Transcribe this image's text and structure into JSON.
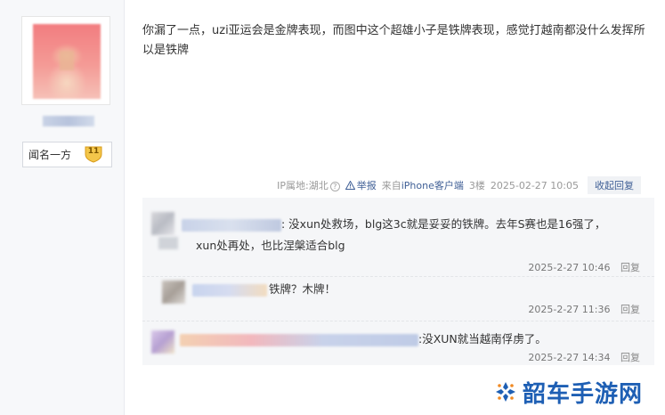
{
  "author": {
    "title": "闻名一方",
    "level": "11"
  },
  "post": {
    "content": "你漏了一点，uzi亚运会是金牌表现，而图中这个超雄小子是铁牌表现，感觉打越南都没什么发挥所以是铁牌",
    "ip_location": "IP属地:湖北",
    "report_label": "举报",
    "source_prefix": "来自",
    "source_device": "iPhone客户端",
    "floor": "3楼",
    "datetime": "2025-02-27 10:05",
    "collapse_label": "收起回复"
  },
  "replies": [
    {
      "line1": ": 没xun处救场，blg这3c就是妥妥的铁牌。去年S赛也是16强了，",
      "line2": "xun处再处，也比涅槃适合blg",
      "time": "2025-2-27 10:46",
      "reply_label": "回复"
    },
    {
      "line1": "铁牌？木牌！",
      "time": "2025-2-27 11:36",
      "reply_label": "回复"
    },
    {
      "line1": ":没XUN就当越南俘虏了。",
      "time": "2025-2-27 14:34",
      "reply_label": "回复"
    }
  ],
  "watermark": {
    "text": "韶车手游网"
  },
  "colors": {
    "link": "#3f5f96",
    "reply_bg": "#f5f6f8",
    "watermark": "#1e5fb4",
    "level_badge": "#f3c64a"
  }
}
